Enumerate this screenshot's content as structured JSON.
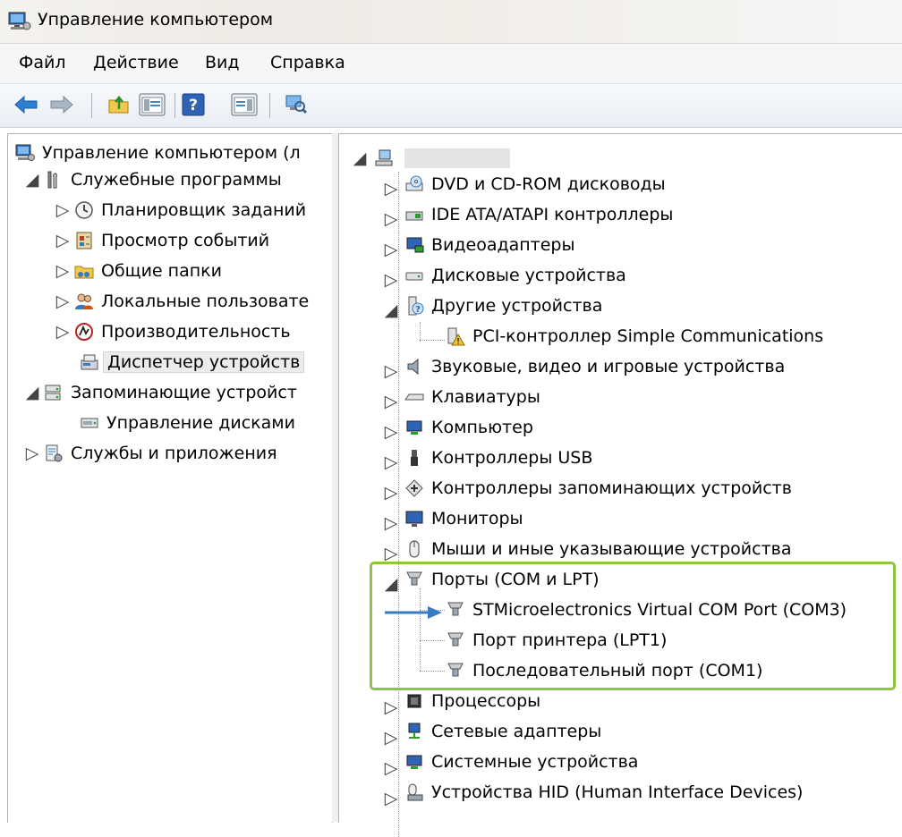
{
  "window": {
    "title": "Управление компьютером"
  },
  "menu": {
    "items": [
      "Файл",
      "Действие",
      "Вид",
      "Справка"
    ]
  },
  "left_tree": {
    "root": "Управление компьютером (л",
    "system_tools": "Служебные программы",
    "task_scheduler": "Планировщик заданий",
    "event_viewer": "Просмотр событий",
    "shared_folders": "Общие папки",
    "local_users": "Локальные пользовате",
    "performance": "Производительность",
    "device_manager": "Диспетчер устройств",
    "storage": "Запоминающие устройст",
    "disk_management": "Управление дисками",
    "services": "Службы и приложения"
  },
  "device_tree": {
    "computer_name": "",
    "categories": {
      "dvd": "DVD и CD-ROM дисководы",
      "ide": "IDE ATA/ATAPI контроллеры",
      "video": "Видеоадаптеры",
      "disks": "Дисковые устройства",
      "other": "Другие устройства",
      "other_child": "PCI-контроллер Simple Communications",
      "sound": "Звуковые, видео и игровые устройства",
      "keyboards": "Клавиатуры",
      "computer": "Компьютер",
      "usb": "Контроллеры USB",
      "storage_ctrl": "Контроллеры запоминающих устройств",
      "monitors": "Мониторы",
      "mice": "Мыши и иные указывающие устройства",
      "ports": "Порты (COM и LPT)",
      "port_stm": "STMicroelectronics Virtual COM Port (COM3)",
      "port_lpt": "Порт принтера (LPT1)",
      "port_com1": "Последовательный порт (COM1)",
      "cpu": "Процессоры",
      "network": "Сетевые адаптеры",
      "system": "Системные устройства",
      "hid": "Устройства HID (Human Interface Devices)"
    }
  },
  "colors": {
    "highlight": "#8cc53f",
    "arrow": "#3a7abf",
    "nav_arrow": "#2f7fd0"
  }
}
